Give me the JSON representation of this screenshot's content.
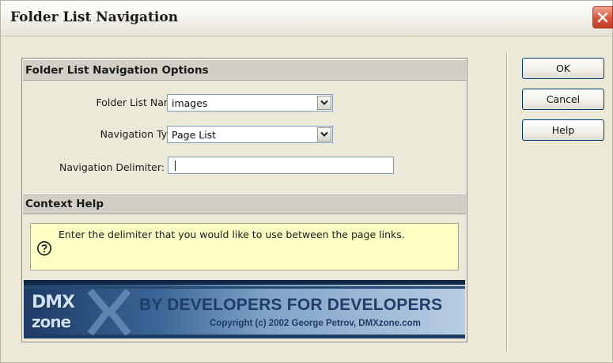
{
  "window": {
    "title": "Folder List Navigation"
  },
  "options": {
    "header": "Folder List Navigation Options",
    "folder_list_name": {
      "label": "Folder List Name:",
      "value": "images"
    },
    "navigation_type": {
      "label": "Navigation Type:",
      "value": "Page List"
    },
    "navigation_delimiter": {
      "label": "Navigation Delimiter:",
      "value": ""
    }
  },
  "context_help": {
    "header": "Context Help",
    "text": "Enter the delimiter that you would like to use between the page links."
  },
  "banner": {
    "logo_line1": "DMX",
    "logo_line2": "zone",
    "slogan": "BY DEVELOPERS FOR DEVELOPERS",
    "copyright": "Copyright (c) 2002 George Petrov, DMXzone.com"
  },
  "buttons": {
    "ok": "OK",
    "cancel": "Cancel",
    "help": "Help"
  },
  "colors": {
    "dialog_bg": "#ece9d8",
    "help_bg": "#ffffc6",
    "close_red": "#d9523a",
    "banner_blue": "#1f3d68"
  }
}
